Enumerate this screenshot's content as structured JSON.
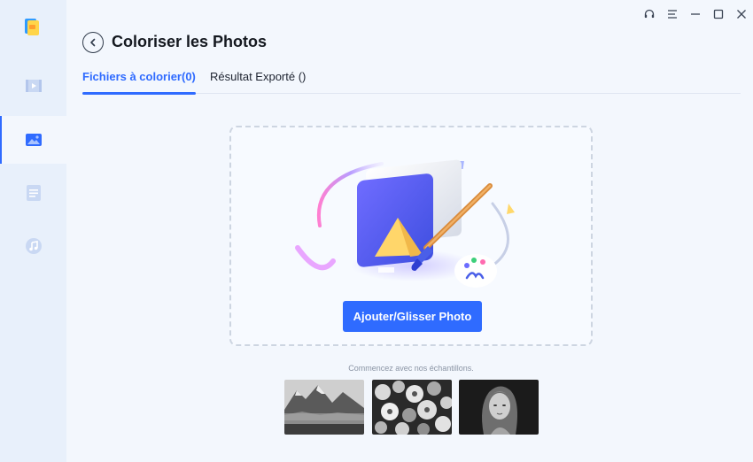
{
  "app": {
    "logo_icon": "app-logo-icon"
  },
  "sidebar": {
    "items": [
      {
        "name": "video",
        "icon": "video-icon",
        "active": false
      },
      {
        "name": "photo",
        "icon": "image-icon",
        "active": true
      },
      {
        "name": "document",
        "icon": "document-icon",
        "active": false
      },
      {
        "name": "audio",
        "icon": "music-icon",
        "active": false
      }
    ]
  },
  "window_controls": [
    "headset-icon",
    "menu-icon",
    "minimize-icon",
    "maximize-icon",
    "close-icon"
  ],
  "header": {
    "title": "Coloriser les Photos"
  },
  "tabs": [
    {
      "label": "Fichiers à colorier(0)",
      "active": true
    },
    {
      "label": "Résultat Exporté ()",
      "active": false
    }
  ],
  "dropzone": {
    "button_label": "Ajouter/Glisser Photo"
  },
  "samples": {
    "label": "Commencez avec nos échantillons.",
    "items": [
      "mountain-lake-sample",
      "flowers-sample",
      "portrait-sample"
    ]
  },
  "colors": {
    "accent": "#2f6bff",
    "sidebar_bg": "#e8f0fb",
    "page_bg": "#f3f7fd"
  }
}
